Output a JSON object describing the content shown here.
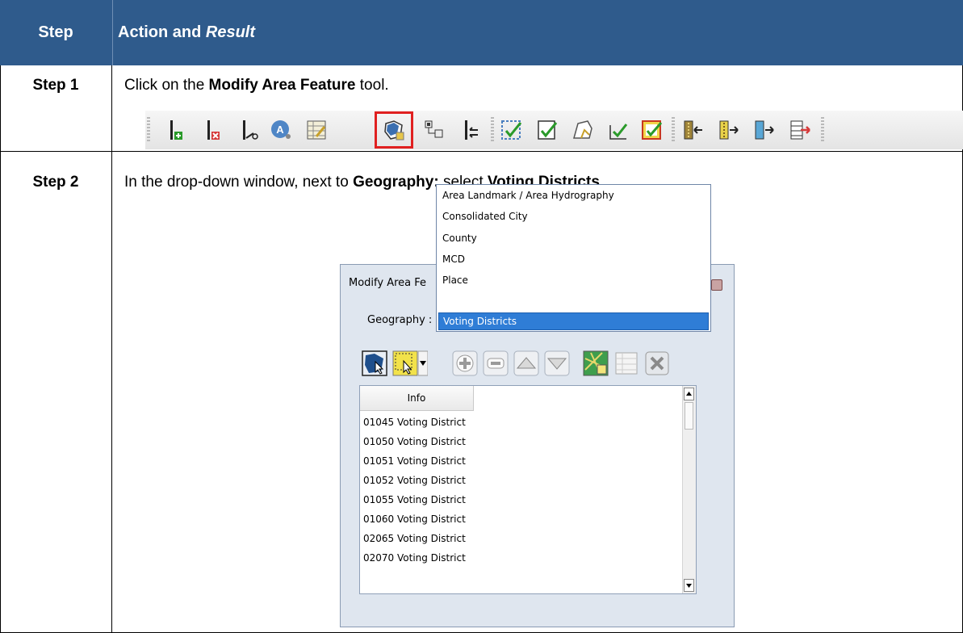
{
  "header": {
    "step_col": "Step",
    "action_col_prefix": "Action and ",
    "action_col_italic": "Result"
  },
  "step1": {
    "label": "Step 1",
    "text_before": "Click on the ",
    "bold": "Modify Area Feature",
    "text_after": " tool."
  },
  "step2": {
    "label": "Step 2",
    "text_before": "In the drop-down window, next to ",
    "bold1": "Geography:",
    "text_mid": " select ",
    "bold2": "Voting Districts",
    "text_after": "."
  },
  "dialog": {
    "title": "Modify Area Fe",
    "geography_label": "Geography :",
    "dropdown_options": [
      "Area Landmark / Area Hydrography",
      "Consolidated City",
      "County",
      "MCD",
      "Place",
      "Voting Districts"
    ],
    "selected_option": "Voting Districts",
    "grid_header": "Info",
    "rows": [
      "01045 Voting District",
      "01050 Voting District",
      "01051 Voting District",
      "01052 Voting District",
      "01055 Voting District",
      "01060 Voting District",
      "02065 Voting District",
      "02070 Voting District"
    ]
  },
  "colors": {
    "header_bg": "#2f5b8c",
    "highlight": "#e02020",
    "selection": "#2f7dd6"
  }
}
